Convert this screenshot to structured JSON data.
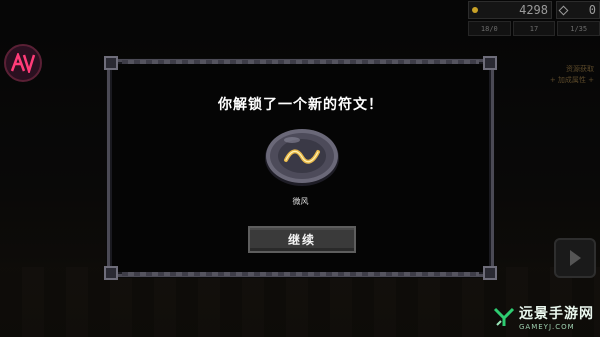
{
  "hud": {
    "gold": "4298",
    "gems": "0",
    "stats": [
      "18/0",
      "17",
      "1/35"
    ]
  },
  "side_hints": [
    "资源获取",
    "+ 加成属性 +"
  ],
  "dialog": {
    "title": "你解锁了一个新的符文！",
    "rune_name": "微风",
    "rune_icon": "breeze-wave-icon",
    "continue_label": "继续"
  },
  "watermark": {
    "cn": "远景手游网",
    "en": "GAMEYJ.COM"
  },
  "colors": {
    "rune_wave": "#e8b84a",
    "rune_stone": "#5a5868",
    "logo_accent": "#ff3c78",
    "watermark_green": "#2ecc71"
  }
}
